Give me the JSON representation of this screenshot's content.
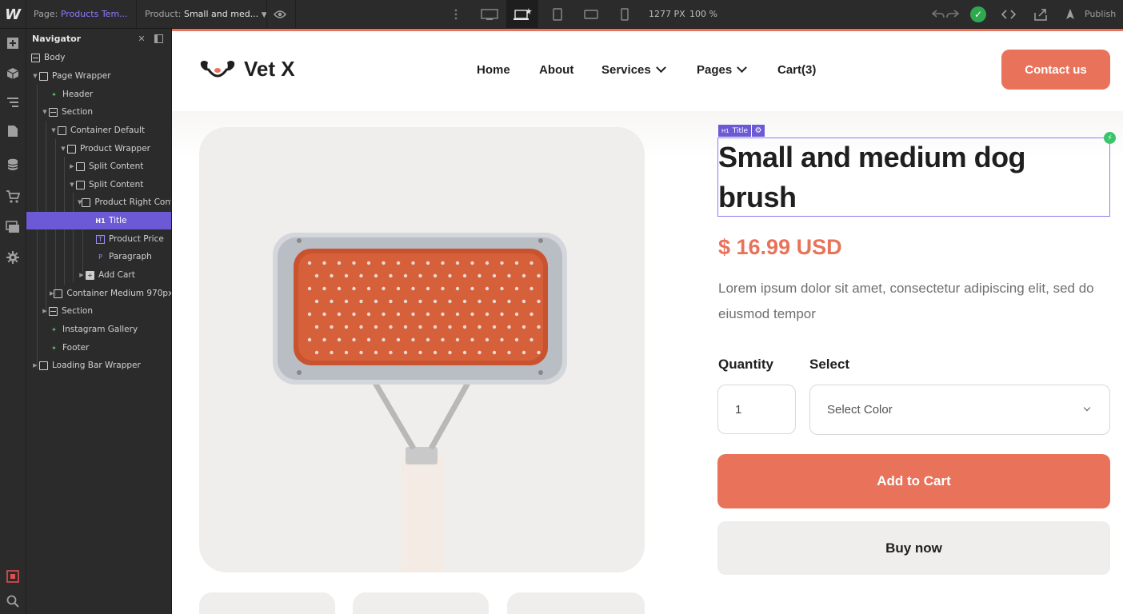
{
  "topbar": {
    "logo": "W",
    "page_label": "Page:",
    "page_value": "Products Tem...",
    "product_label": "Product:",
    "product_value": "Small and med...",
    "canvas_width": "1277 PX",
    "zoom": "100 %",
    "publish": "Publish"
  },
  "navigator": {
    "title": "Navigator",
    "items": [
      {
        "label": "Body"
      },
      {
        "label": "Page Wrapper"
      },
      {
        "label": "Header"
      },
      {
        "label": "Section"
      },
      {
        "label": "Container Default"
      },
      {
        "label": "Product Wrapper"
      },
      {
        "label": "Split Content"
      },
      {
        "label": "Split Content"
      },
      {
        "label": "Product Right Cont"
      },
      {
        "label": "Title",
        "icon_text": "H1"
      },
      {
        "label": "Product Price",
        "icon_text": "T"
      },
      {
        "label": "Paragraph",
        "icon_text": "P"
      },
      {
        "label": "Add Cart"
      },
      {
        "label": "Container Medium 970px"
      },
      {
        "label": "Section"
      },
      {
        "label": "Instagram Gallery"
      },
      {
        "label": "Footer"
      },
      {
        "label": "Loading Bar Wrapper"
      }
    ]
  },
  "site": {
    "brand": "Vet X",
    "menu": {
      "home": "Home",
      "about": "About",
      "services": "Services",
      "pages": "Pages",
      "cart": "Cart(3)"
    },
    "contact_button": "Contact us"
  },
  "selection": {
    "tag_prefix": "H1",
    "tag_label": "Title"
  },
  "product": {
    "title": "Small and medium dog brush",
    "price": "$ 16.99 USD",
    "description": "Lorem ipsum dolor sit amet, consectetur adipiscing elit, sed do eiusmod tempor",
    "quantity_label": "Quantity",
    "quantity_value": "1",
    "select_label": "Select",
    "select_value": "Select Color",
    "add_to_cart": "Add to Cart",
    "buy_now": "Buy now"
  },
  "colors": {
    "accent": "#e8735a",
    "selection": "#6c59d6",
    "success": "#2fa84f"
  }
}
